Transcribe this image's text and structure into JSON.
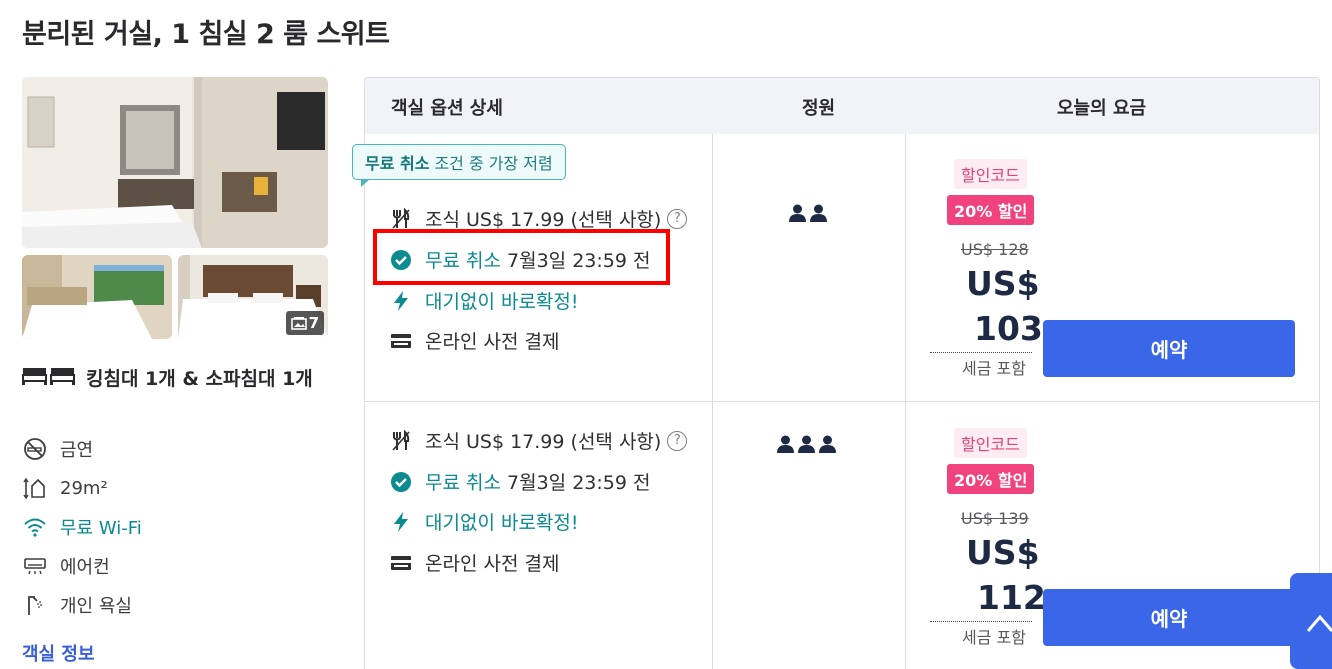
{
  "room_title": "분리된 거실, 1 침실 2 룸 스위트",
  "photos": {
    "count": "7"
  },
  "bed": {
    "text": "킹침대 1개 & 소파침대 1개"
  },
  "amenities": [
    {
      "label": "금연",
      "icon": "no-smoking-icon"
    },
    {
      "label": "29m²",
      "icon": "room-size-icon"
    },
    {
      "label": "무료 Wi-Fi",
      "icon": "wifi-icon"
    },
    {
      "label": "에어컨",
      "icon": "air-conditioner-icon"
    },
    {
      "label": "개인 욕실",
      "icon": "shower-icon"
    }
  ],
  "room_info_link": "객실 정보",
  "table_header": {
    "options": "객실 옵션 상세",
    "capacity": "정원",
    "price": "오늘의 요금"
  },
  "cheapest_badge": {
    "bold": "무료 취소",
    "rest": "조건 중 가장 저렴"
  },
  "offers": [
    {
      "breakfast": "조식 US$ 17.99 (선택 사항)",
      "free_cancel": "무료 취소",
      "cancel_deadline": "7월3일 23:59 전",
      "instant": "대기없이 바로확정!",
      "payment": "온라인 사전 결제",
      "guests": 2,
      "promo_tag": "할인코드",
      "discount_tag": "20% 할인",
      "original_price": "US$ 128",
      "currency": "US$",
      "price": "103",
      "tax_note": "세금 포함",
      "book_label": "예약"
    },
    {
      "breakfast": "조식 US$ 17.99 (선택 사항)",
      "free_cancel": "무료 취소",
      "cancel_deadline": "7월3일 23:59 전",
      "instant": "대기없이 바로확정!",
      "payment": "온라인 사전 결제",
      "guests": 3,
      "promo_tag": "할인코드",
      "discount_tag": "20% 할인",
      "original_price": "US$ 139",
      "currency": "US$",
      "price": "112",
      "tax_note": "세금 포함",
      "book_label": "예약"
    }
  ],
  "colors": {
    "accent": "#3a67e8",
    "teal": "#0b8a8f",
    "discount": "#f0427c",
    "highlight": "#ff0000"
  }
}
